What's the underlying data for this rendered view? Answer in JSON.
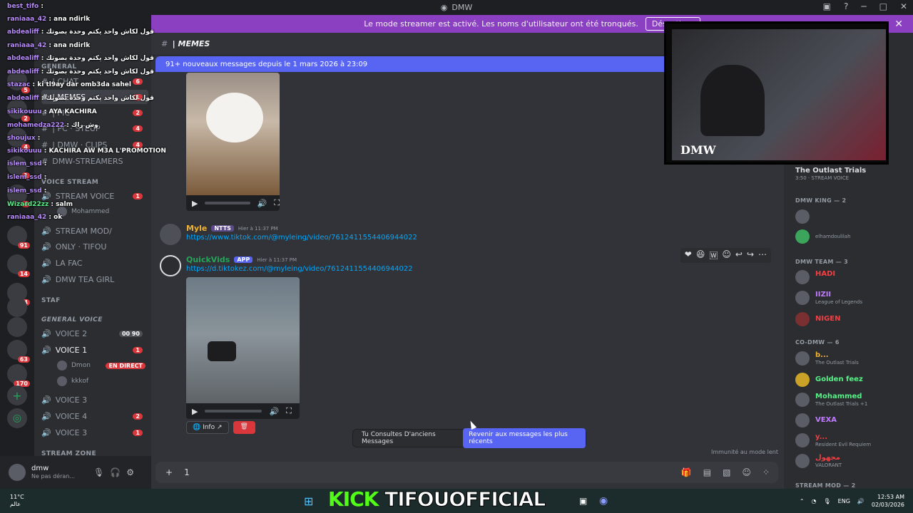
{
  "window": {
    "title": "DMW"
  },
  "streamer_banner": {
    "text": "Le mode streamer est activé. Les noms d'utilisateur ont été tronqués.",
    "button": "Désactiver"
  },
  "server_badges": [
    "5",
    "2",
    "4",
    "1",
    "4",
    "91",
    "14",
    "34",
    "63",
    "170"
  ],
  "channels": [
    {
      "label": "GENERAL",
      "type": "category"
    },
    {
      "label": "| CHAT",
      "count": "6"
    },
    {
      "label": "| MEMES",
      "count": "1"
    },
    {
      "label": "| PIC",
      "count": "2"
    },
    {
      "label": "| PC · STEUP",
      "count": "4"
    },
    {
      "label": "| DMW · CLIPS",
      "count": "4"
    },
    {
      "label": "DMW-STREAMERS"
    },
    {
      "label": "VOICE STREAM",
      "type": "category"
    },
    {
      "label": "STREAM VOICE",
      "count": "1"
    },
    {
      "label": "Mohammed"
    },
    {
      "label": "STREAM MOD/"
    },
    {
      "label": "ONLY · TIFOU"
    },
    {
      "label": "LA FAC"
    },
    {
      "label": "DMW TEA GIRL"
    },
    {
      "label": "STAF",
      "type": "category"
    },
    {
      "label": "GENERAL VOICE",
      "type": "category"
    },
    {
      "label": "VOICE 2",
      "count": "00 90"
    },
    {
      "label": "VOICE 1",
      "count": "1"
    },
    {
      "label": "Dmon",
      "live": "EN DIRECT"
    },
    {
      "label": "kkkof"
    },
    {
      "label": "VOICE 3"
    },
    {
      "label": "VOICE 4",
      "count": "2"
    },
    {
      "label": "VOICE 3",
      "count": "1"
    },
    {
      "label": "STREAM ZONE",
      "type": "category"
    }
  ],
  "user_panel": {
    "name": "dmw",
    "status": "Ne pas déran..."
  },
  "channel_header": {
    "name": "| MEMES"
  },
  "new_messages_bar": "91+ nouveaux messages depuis le 1 mars 2026 à 23:09",
  "messages": [
    {
      "author": "Myle",
      "tag": "NTTS",
      "time": "Hier à 11:37 PM",
      "link": "https://www.tiktok.com/@myleing/video/7612411554406944022"
    },
    {
      "author": "QuickVids",
      "tag": "APP",
      "time": "Hier à 11:37 PM",
      "link": "https://d.tiktokez.com/@myleing/video/7612411554406944022"
    }
  ],
  "embed_info": "Info",
  "jump_bar": {
    "text": "Tu Consultes D'anciens Messages",
    "button": "Revenir aux messages les plus récents"
  },
  "slowmode": "Immunité au mode lent",
  "composer": {
    "value": "1"
  },
  "members": {
    "sections": [
      {
        "title": "DMW KING — 2"
      },
      {
        "title": "DMW TEAM — 3"
      },
      {
        "title": "CO-DMW — 6"
      },
      {
        "title": "STREAM MOD — 2"
      }
    ],
    "top": {
      "name": "The Outlast Trials",
      "status": "3:50 · STREAM VOICE"
    },
    "list": [
      {
        "name": "",
        "status": ""
      },
      {
        "name": "",
        "status": "elhamdoulilah"
      },
      {
        "name": "HADI",
        "status": ""
      },
      {
        "name": "IIZII",
        "status": "League of Legends"
      },
      {
        "name": "NIGEN",
        "status": ""
      },
      {
        "name": "b...",
        "status": "The Outlast Trials"
      },
      {
        "name": "Golden feez",
        "status": ""
      },
      {
        "name": "Mohammed",
        "status": "The Outlast Trials +1"
      },
      {
        "name": "VEXA",
        "status": ""
      },
      {
        "name": "y...",
        "status": "Resident Evil Requiem"
      },
      {
        "name": "مجهول",
        "status": "VALORANT"
      }
    ]
  },
  "webcam": {
    "logo": "DMW"
  },
  "chat_overlay": [
    {
      "user": "raniaaa_42",
      "text": "ana ndirlk"
    },
    {
      "user": "abdealiff",
      "text": "قول لكاش واحد يكتم وحدة بصوتك"
    },
    {
      "user": "raniaaa_42",
      "text": "ana ndirlk"
    },
    {
      "user": "abdealiff",
      "text": "قول لكاش واحد يكتم وحدة بصوتك"
    },
    {
      "user": "abdealiff",
      "text": "قول لكاش واحد يكتم وحدة بصوتك"
    },
    {
      "user": "stazac",
      "text": "ki tl9ay dar omb3da sahel"
    },
    {
      "user": "abdealiff",
      "text": "قول لكاش واحد يكتم وحدة بصوتك"
    },
    {
      "user": "sikikouuu",
      "text": "AYA KACHIRA"
    },
    {
      "user": "mohamedza222",
      "text": "وش راك"
    },
    {
      "user": "shoujux",
      "text": ""
    },
    {
      "user": "sikikouuu",
      "text": "KACHIRA AW M3A L'PROMOTION"
    },
    {
      "user": "islem_ssd",
      "text": ""
    },
    {
      "user": "islem_ssd",
      "text": ""
    },
    {
      "user": "islem_ssd",
      "text": ""
    },
    {
      "user": "Wizard22zz",
      "text": "salm"
    },
    {
      "user": "raniaaa_42",
      "text": "ok"
    }
  ],
  "overlay_top": {
    "user": "best_tifo",
    "text": ""
  },
  "taskbar": {
    "weather": "11°C",
    "weather_sub": "عالم",
    "kick_label": "KICK",
    "channel": "TIFOUOFFICIAL",
    "lang": "ENG",
    "time": "12:53 AM",
    "date": "02/03/2026"
  },
  "colors": {
    "accent": "#5865f2",
    "streamer": "#8b3fc1",
    "kick": "#53fc18",
    "link": "#00a8fc"
  }
}
